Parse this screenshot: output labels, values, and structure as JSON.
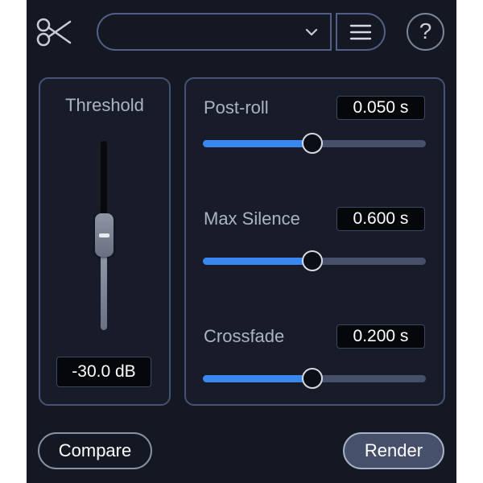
{
  "toolbar": {
    "preset_value": "",
    "help_label": "?"
  },
  "threshold": {
    "label": "Threshold",
    "value_text": "-30.0 dB",
    "fader_level": 0.55
  },
  "params": [
    {
      "label": "Post-roll",
      "value_text": "0.050 s",
      "slider_level": 0.5
    },
    {
      "label": "Max Silence",
      "value_text": "0.600 s",
      "slider_level": 0.5
    },
    {
      "label": "Crossfade",
      "value_text": "0.200 s",
      "slider_level": 0.5
    }
  ],
  "buttons": {
    "compare_label": "Compare",
    "render_label": "Render"
  },
  "colors": {
    "background": "#141823",
    "accent": "#3b87f2",
    "border": "#465374"
  },
  "icons": {
    "logo": "scissors-icon",
    "preset_dropdown": "chevron-down-icon",
    "menu": "hamburger-menu-icon",
    "help": "question-mark-icon"
  }
}
